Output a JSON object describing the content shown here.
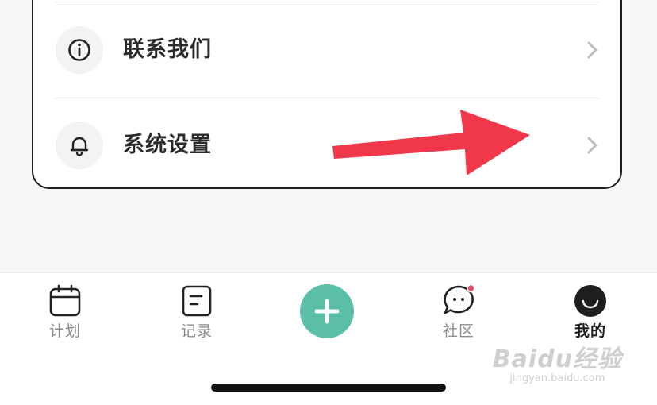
{
  "menu": {
    "items": [
      {
        "label": "联系我们",
        "icon": "info-icon"
      },
      {
        "label": "系统设置",
        "icon": "bell-icon"
      }
    ]
  },
  "tabbar": {
    "tabs": [
      {
        "label": "计划",
        "icon": "calendar-icon",
        "active": false
      },
      {
        "label": "记录",
        "icon": "note-icon",
        "active": false
      },
      {
        "label": "",
        "icon": "plus-icon",
        "active": false
      },
      {
        "label": "社区",
        "icon": "chat-bubble-icon",
        "active": false,
        "badge": true
      },
      {
        "label": "我的",
        "icon": "smile-avatar-icon",
        "active": true
      }
    ]
  },
  "watermark": {
    "title": "Baidu经验",
    "url": "jingyan.baidu.com"
  },
  "colors": {
    "accent": "#5bbfa8",
    "annotation_arrow": "#f0384a",
    "badge": "#e8506a",
    "card_border": "#1e1e1e"
  }
}
